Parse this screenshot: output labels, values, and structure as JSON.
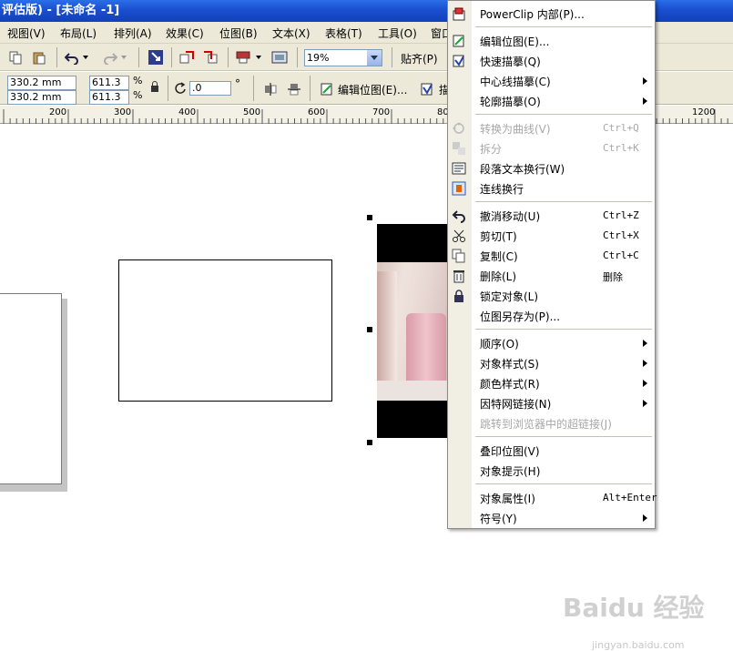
{
  "window": {
    "title": "评估版) - [未命名 -1]"
  },
  "menubar": [
    "视图(V)",
    "布局(L)",
    "排列(A)",
    "效果(C)",
    "位图(B)",
    "文本(X)",
    "表格(T)",
    "工具(O)",
    "窗口"
  ],
  "toolbar1": {
    "zoom_value": "19%",
    "snap_label": "贴齐(P)"
  },
  "toolbar2": {
    "pos_x": "330.2 mm",
    "pos_y": "330.2 mm",
    "scale_x": "611.3",
    "scale_y": "611.3",
    "percent_symbol": "%",
    "angle": ".0",
    "degree_symbol": "°",
    "edit_bitmap_label": "编辑位图(E)...",
    "trace_label": "描"
  },
  "ruler": {
    "ticks": [
      "200",
      "300",
      "400",
      "500",
      "600",
      "700",
      "800",
      "1200"
    ]
  },
  "context_menu": {
    "items": [
      {
        "label": "PowerClip 内部(P)...",
        "shortcut": "",
        "submenu": false,
        "disabled": false,
        "icon": "powerclip-icon"
      },
      {
        "separator": true
      },
      {
        "label": "编辑位图(E)...",
        "shortcut": "",
        "submenu": false,
        "disabled": false,
        "icon": "edit-bitmap-icon"
      },
      {
        "label": "快速描摹(Q)",
        "shortcut": "",
        "submenu": false,
        "disabled": false,
        "icon": "quick-trace-icon"
      },
      {
        "label": "中心线描摹(C)",
        "shortcut": "",
        "submenu": true,
        "disabled": false,
        "icon": ""
      },
      {
        "label": "轮廓描摹(O)",
        "shortcut": "",
        "submenu": true,
        "disabled": false,
        "icon": ""
      },
      {
        "separator": true
      },
      {
        "label": "转换为曲线(V)",
        "shortcut": "Ctrl+Q",
        "submenu": false,
        "disabled": true,
        "icon": "convert-curves-icon"
      },
      {
        "label": "拆分",
        "shortcut": "Ctrl+K",
        "submenu": false,
        "disabled": true,
        "icon": "break-apart-icon"
      },
      {
        "label": "段落文本换行(W)",
        "shortcut": "",
        "submenu": false,
        "disabled": false,
        "icon": "text-wrap-icon"
      },
      {
        "label": "连线换行",
        "shortcut": "",
        "submenu": false,
        "disabled": false,
        "icon": "line-wrap-icon"
      },
      {
        "separator": true
      },
      {
        "label": "撤消移动(U)",
        "shortcut": "Ctrl+Z",
        "submenu": false,
        "disabled": false,
        "icon": "undo-icon"
      },
      {
        "label": "剪切(T)",
        "shortcut": "Ctrl+X",
        "submenu": false,
        "disabled": false,
        "icon": "scissors-icon"
      },
      {
        "label": "复制(C)",
        "shortcut": "Ctrl+C",
        "submenu": false,
        "disabled": false,
        "icon": "copy-icon"
      },
      {
        "label": "删除(L)",
        "shortcut": "删除",
        "submenu": false,
        "disabled": false,
        "icon": "trash-icon"
      },
      {
        "label": "锁定对象(L)",
        "shortcut": "",
        "submenu": false,
        "disabled": false,
        "icon": "lock-icon"
      },
      {
        "label": "位图另存为(P)...",
        "shortcut": "",
        "submenu": false,
        "disabled": false,
        "icon": ""
      },
      {
        "separator": true
      },
      {
        "label": "顺序(O)",
        "shortcut": "",
        "submenu": true,
        "disabled": false,
        "icon": ""
      },
      {
        "label": "对象样式(S)",
        "shortcut": "",
        "submenu": true,
        "disabled": false,
        "icon": ""
      },
      {
        "label": "颜色样式(R)",
        "shortcut": "",
        "submenu": true,
        "disabled": false,
        "icon": ""
      },
      {
        "label": "因特网链接(N)",
        "shortcut": "",
        "submenu": true,
        "disabled": false,
        "icon": ""
      },
      {
        "label": "跳转到浏览器中的超链接(J)",
        "shortcut": "",
        "submenu": false,
        "disabled": true,
        "icon": ""
      },
      {
        "separator": true
      },
      {
        "label": "叠印位图(V)",
        "shortcut": "",
        "submenu": false,
        "disabled": false,
        "icon": ""
      },
      {
        "label": "对象提示(H)",
        "shortcut": "",
        "submenu": false,
        "disabled": false,
        "icon": ""
      },
      {
        "separator": true
      },
      {
        "label": "对象属性(I)",
        "shortcut": "Alt+Enter",
        "submenu": false,
        "disabled": false,
        "icon": ""
      },
      {
        "label": "符号(Y)",
        "shortcut": "",
        "submenu": true,
        "disabled": false,
        "icon": ""
      }
    ]
  },
  "watermark": {
    "text": "Baidu 经验",
    "url": "jingyan.baidu.com"
  },
  "colors": {
    "title_bar": "#1a4fd0",
    "chrome": "#ece9d8",
    "disabled_text": "#a8a8a8",
    "photo_pink": "#e6b7c0"
  }
}
